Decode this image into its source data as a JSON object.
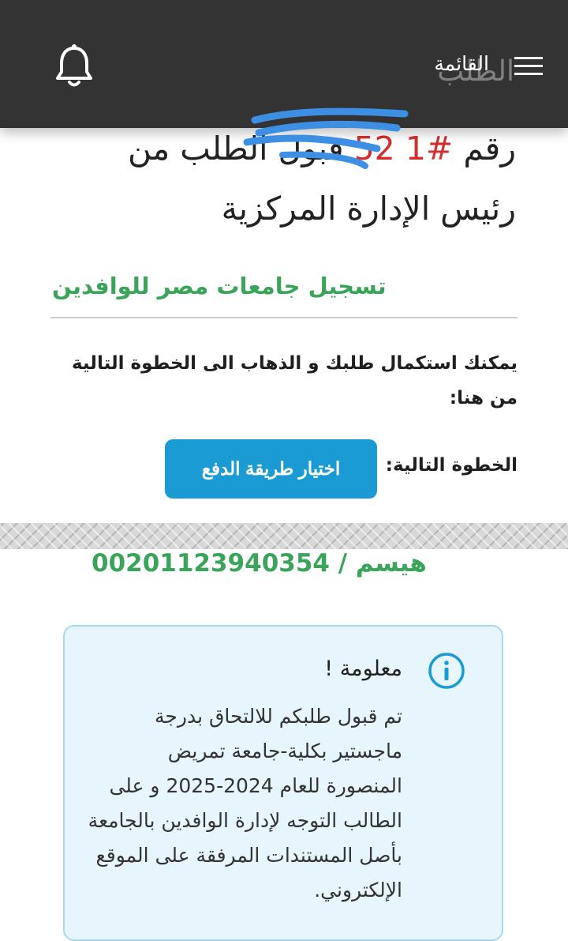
{
  "header": {
    "menu_label": "القائمة",
    "title_behind": "الطلب"
  },
  "heading": {
    "prefix": "رقم",
    "request_number": "#1     52",
    "suffix": "قبول الطلب من رئيس الإدارة المركزية"
  },
  "watermark": {
    "site_name": "تسجيل جامعات مصر للوافدين",
    "contact": "00201123940354 / هيسم"
  },
  "instruction": "يمكنك استكمال طلبك و الذهاب الى الخطوة التالية من هنا:",
  "next_step": {
    "label": "الخطوة التالية:",
    "button_label": "اختيار طريقة الدفع"
  },
  "info": {
    "title": "معلومة !",
    "body": "تم قبول طلبكم للالتحاق بدرجة ماجستير بكلية-جامعة تمريض المنصورة للعام 2024-2025 و على الطالب التوجه لإدارة الوافدين بالجامعة بأصل المستندات المرفقة على الموقع الإلكتروني."
  },
  "colors": {
    "topbar": "#333333",
    "accent_button": "#1a9bd3",
    "request_number": "#d32f2f",
    "watermark_green": "#3aa55a",
    "info_background": "#e7f5fc",
    "info_border": "#a9d9ef"
  },
  "icons": {
    "notification": "bell-icon",
    "menu": "hamburger-icon",
    "info": "info-circle-icon"
  }
}
